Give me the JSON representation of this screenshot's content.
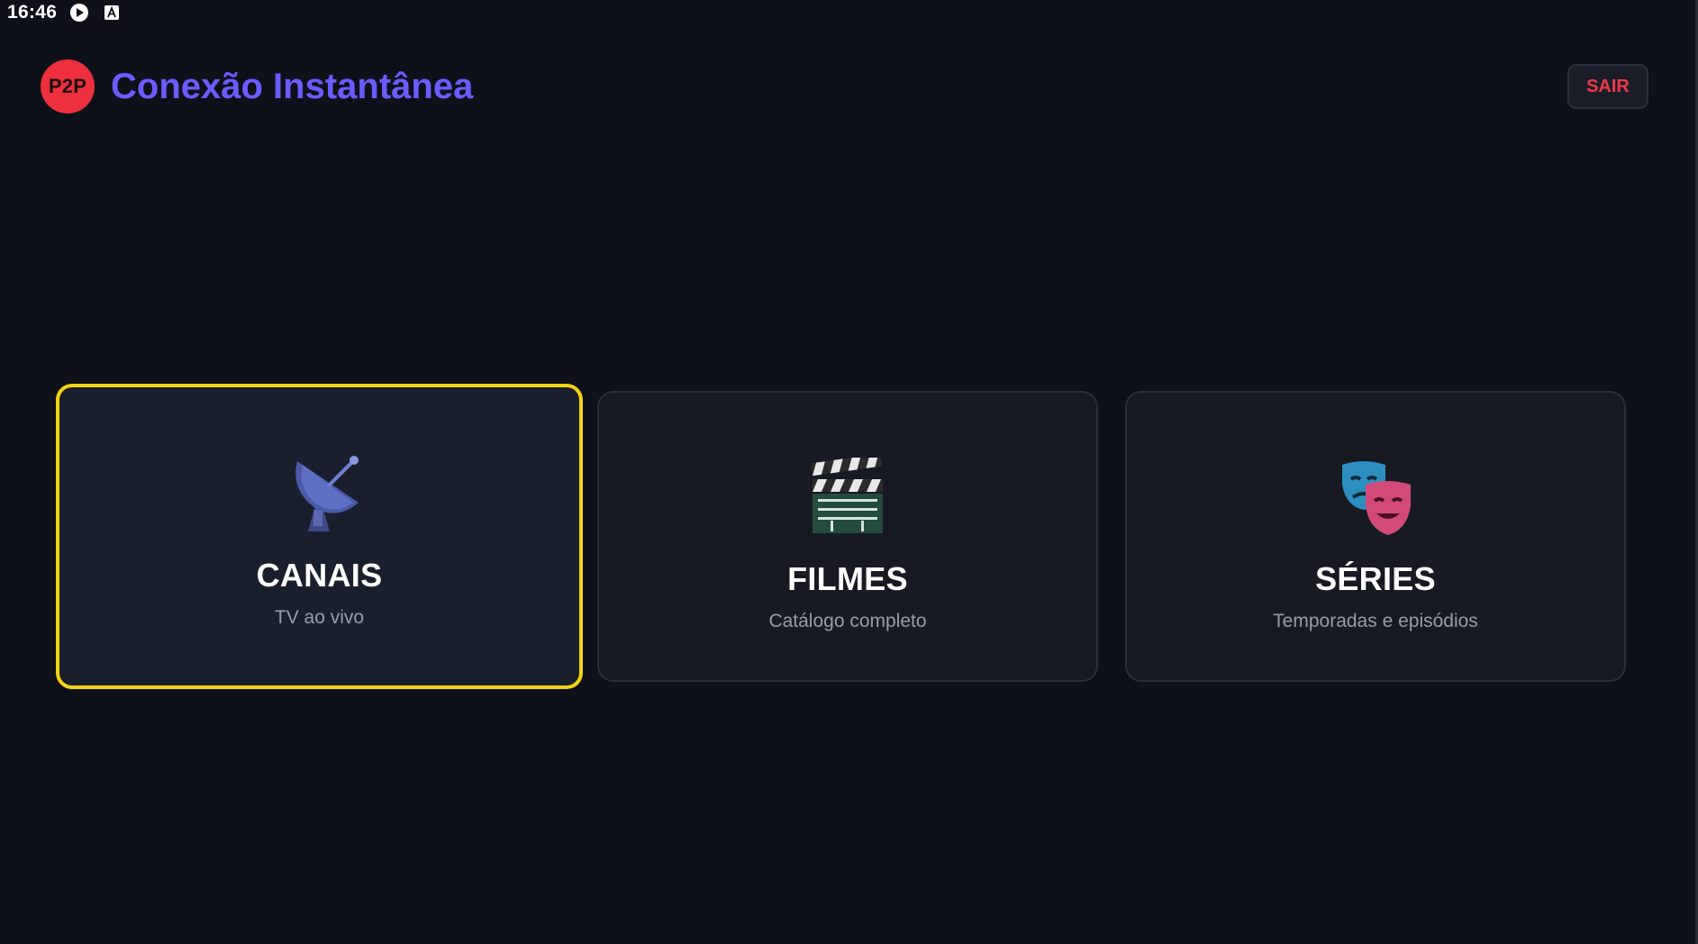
{
  "status_bar": {
    "time": "16:46",
    "icons": [
      "play-store-icon",
      "text-a-icon"
    ]
  },
  "header": {
    "logo_text": "P2P",
    "title": "Conexão Instantânea",
    "exit_label": "SAIR"
  },
  "cards": [
    {
      "title": "CANAIS",
      "subtitle": "TV ao vivo",
      "icon": "satellite-dish-icon",
      "focused": true
    },
    {
      "title": "FILMES",
      "subtitle": "Catálogo completo",
      "icon": "clapper-board-icon",
      "focused": false
    },
    {
      "title": "SÉRIES",
      "subtitle": "Temporadas e episódios",
      "icon": "theater-masks-icon",
      "focused": false
    }
  ],
  "colors": {
    "background": "#0e111a",
    "accent_title": "#6a5cff",
    "logo_red": "#ee2f3d",
    "exit_red": "#ee3a46",
    "focus_yellow": "#f5d312",
    "card_bg": "#171a22"
  }
}
